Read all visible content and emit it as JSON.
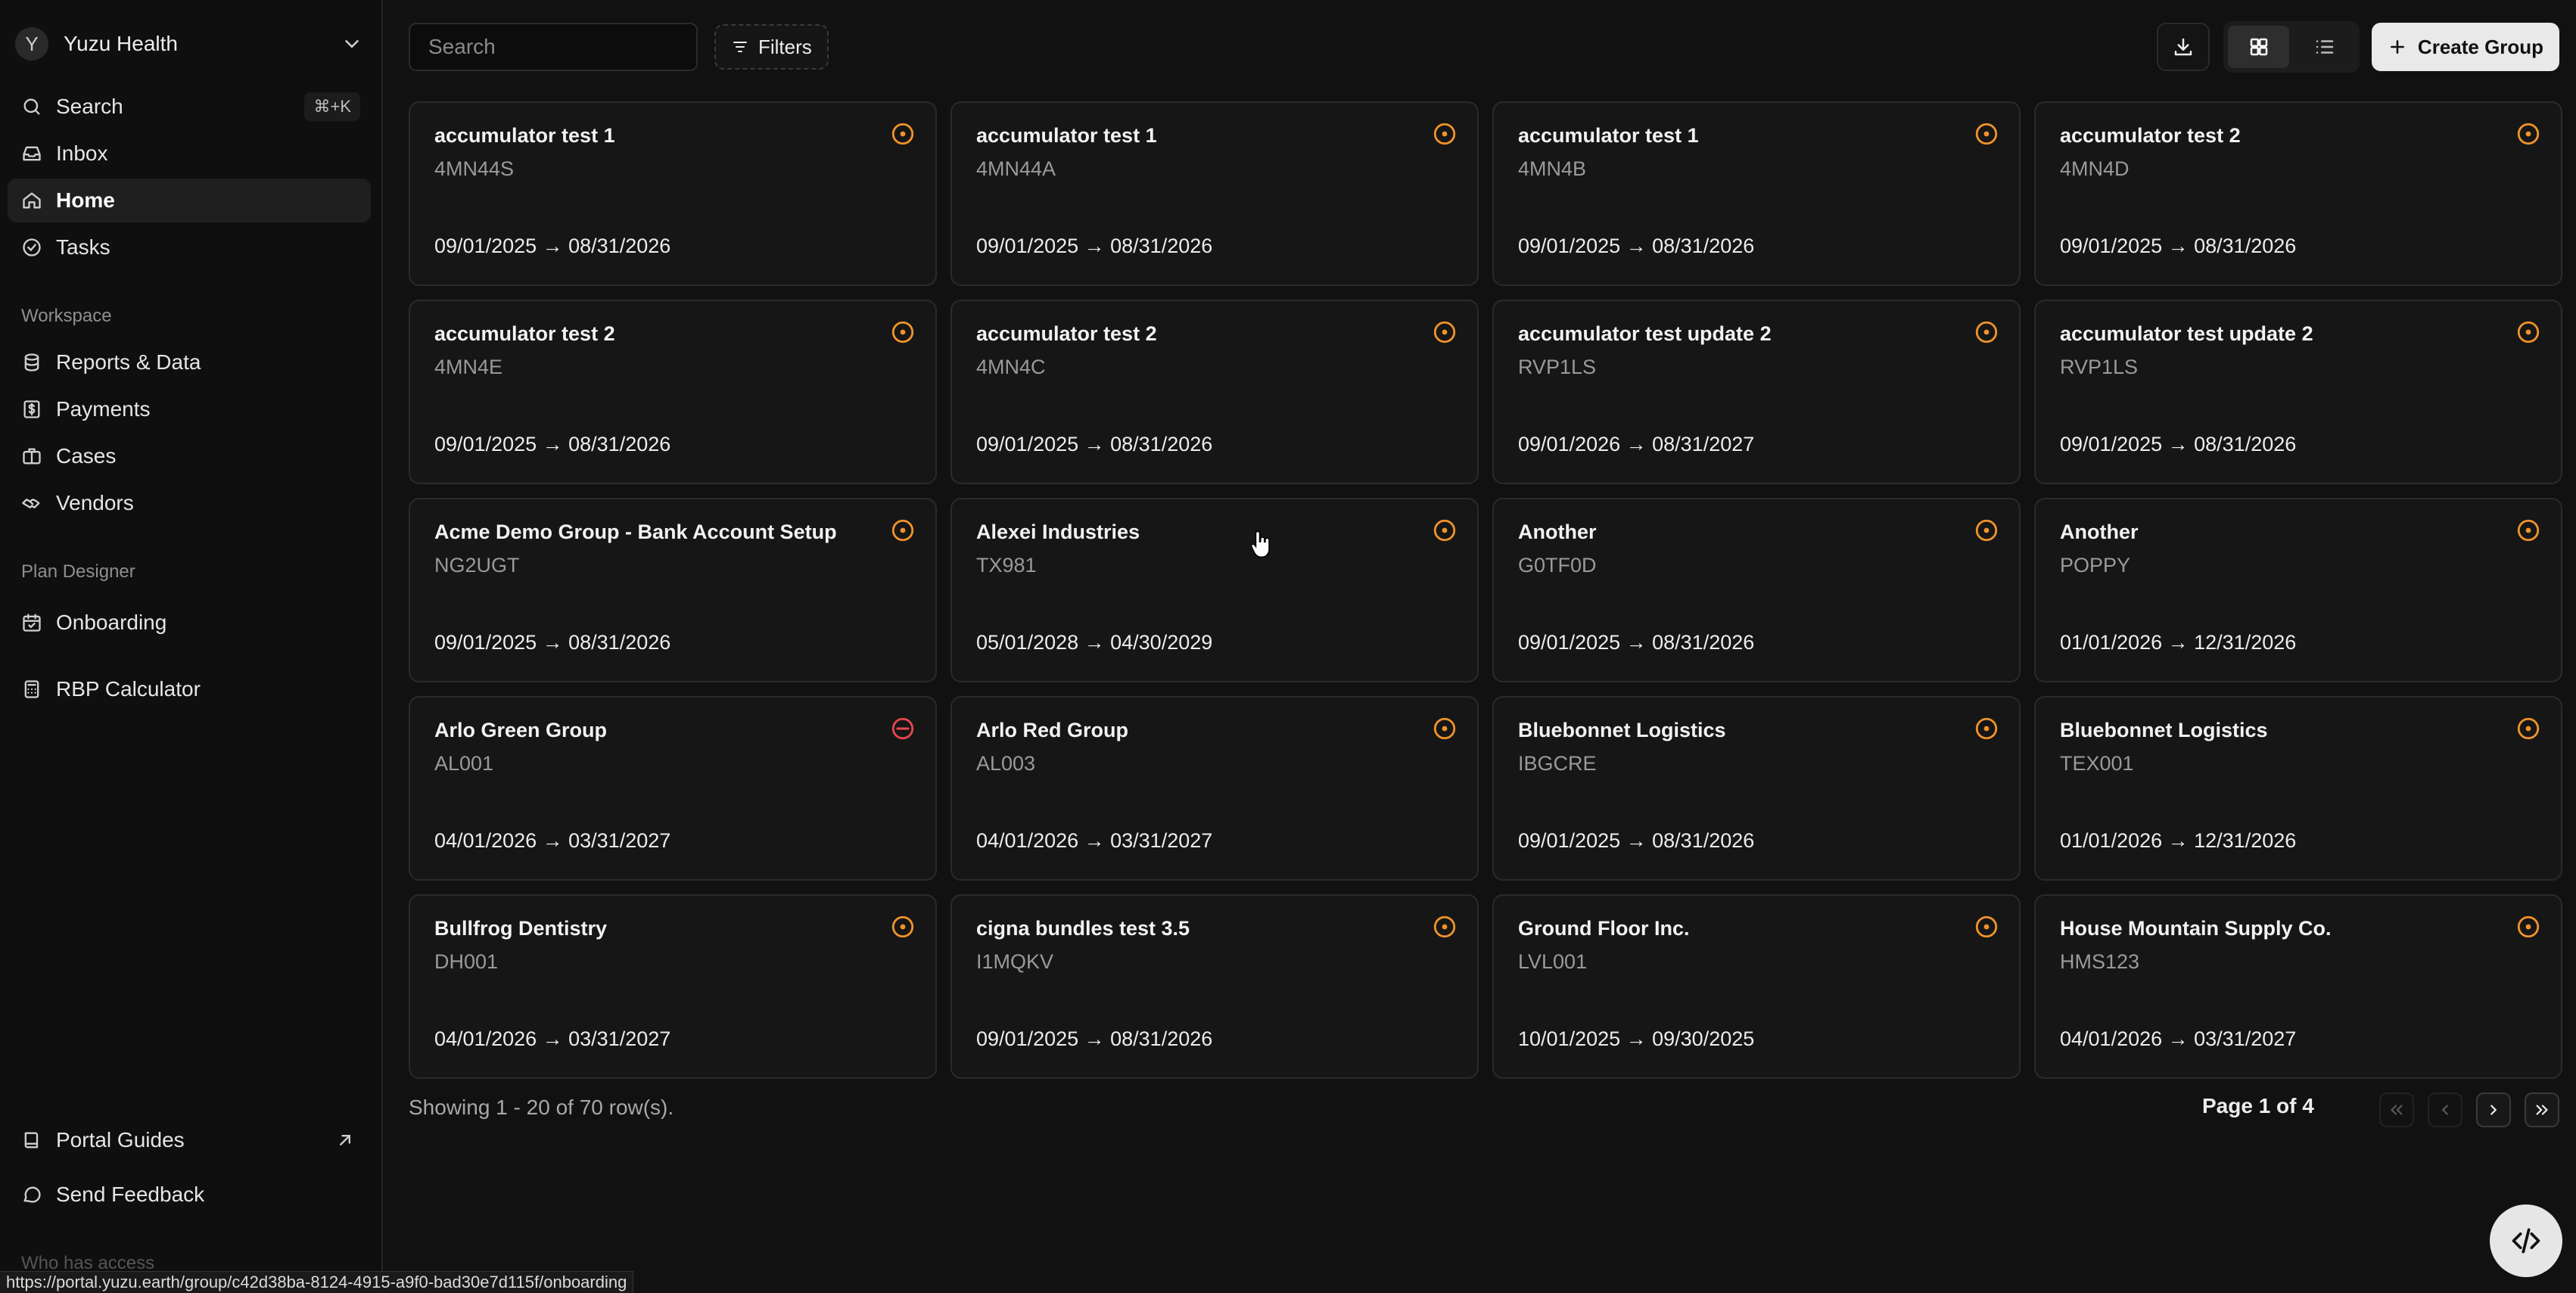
{
  "sidebar": {
    "org": {
      "initial": "Y",
      "name": "Yuzu Health"
    },
    "search": {
      "label": "Search",
      "shortcut": "⌘+K"
    },
    "inbox": "Inbox",
    "home": "Home",
    "tasks": "Tasks",
    "workspace_label": "Workspace",
    "reports": "Reports & Data",
    "payments": "Payments",
    "cases": "Cases",
    "vendors": "Vendors",
    "plan_designer_label": "Plan Designer",
    "onboarding": "Onboarding",
    "rbp_calculator": "RBP Calculator",
    "portal_guides": "Portal Guides",
    "send_feedback": "Send Feedback",
    "who_has_access": "Who has access"
  },
  "toolbar": {
    "search_placeholder": "Search",
    "filters_label": "Filters",
    "create_label": "Create Group"
  },
  "groups": [
    {
      "name": "accumulator test 1",
      "code": "4MN44S",
      "dates": "09/01/2025 → 08/31/2026",
      "status": "active"
    },
    {
      "name": "accumulator test 1",
      "code": "4MN44A",
      "dates": "09/01/2025 → 08/31/2026",
      "status": "active"
    },
    {
      "name": "accumulator test 1",
      "code": "4MN4B",
      "dates": "09/01/2025 → 08/31/2026",
      "status": "active"
    },
    {
      "name": "accumulator test 2",
      "code": "4MN4D",
      "dates": "09/01/2025 → 08/31/2026",
      "status": "active"
    },
    {
      "name": "accumulator test 2",
      "code": "4MN4E",
      "dates": "09/01/2025 → 08/31/2026",
      "status": "active"
    },
    {
      "name": "accumulator test 2",
      "code": "4MN4C",
      "dates": "09/01/2025 → 08/31/2026",
      "status": "active"
    },
    {
      "name": "accumulator test update 2",
      "code": "RVP1LS",
      "dates": "09/01/2026 → 08/31/2027",
      "status": "active"
    },
    {
      "name": "accumulator test update 2",
      "code": "RVP1LS",
      "dates": "09/01/2025 → 08/31/2026",
      "status": "active"
    },
    {
      "name": "Acme Demo Group - Bank Account Setup",
      "code": "NG2UGT",
      "dates": "09/01/2025 → 08/31/2026",
      "status": "active"
    },
    {
      "name": "Alexei Industries",
      "code": "TX981",
      "dates": "05/01/2028 → 04/30/2029",
      "status": "active"
    },
    {
      "name": "Another",
      "code": "G0TF0D",
      "dates": "09/01/2025 → 08/31/2026",
      "status": "active"
    },
    {
      "name": "Another",
      "code": "POPPY",
      "dates": "01/01/2026 → 12/31/2026",
      "status": "active"
    },
    {
      "name": "Arlo Green Group",
      "code": "AL001",
      "dates": "04/01/2026 → 03/31/2027",
      "status": "inactive"
    },
    {
      "name": "Arlo Red Group",
      "code": "AL003",
      "dates": "04/01/2026 → 03/31/2027",
      "status": "active"
    },
    {
      "name": "Bluebonnet Logistics",
      "code": "IBGCRE",
      "dates": "09/01/2025 → 08/31/2026",
      "status": "active"
    },
    {
      "name": "Bluebonnet Logistics",
      "code": "TEX001",
      "dates": "01/01/2026 → 12/31/2026",
      "status": "active"
    },
    {
      "name": "Bullfrog Dentistry",
      "code": "DH001",
      "dates": "04/01/2026 → 03/31/2027",
      "status": "active"
    },
    {
      "name": "cigna bundles test 3.5",
      "code": "I1MQKV",
      "dates": "09/01/2025 → 08/31/2026",
      "status": "active"
    },
    {
      "name": "Ground Floor Inc.",
      "code": "LVL001",
      "dates": "10/01/2025 → 09/30/2025",
      "status": "active"
    },
    {
      "name": "House Mountain Supply Co.",
      "code": "HMS123",
      "dates": "04/01/2026 → 03/31/2027",
      "status": "active"
    }
  ],
  "status_colors": {
    "active": "#f0932b",
    "inactive": "#e5484d"
  },
  "footer": {
    "row_count": "Showing 1 - 20 of 70 row(s).",
    "page_info": "Page 1 of 4"
  },
  "status_url": "https://portal.yuzu.earth/group/c42d38ba-8124-4915-a9f0-bad30e7d115f/onboarding"
}
